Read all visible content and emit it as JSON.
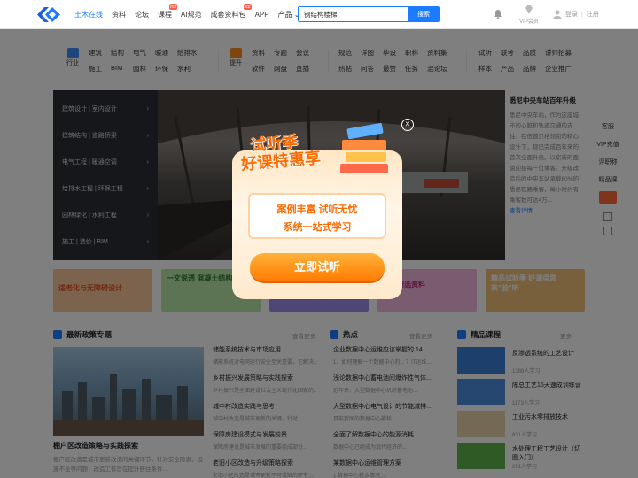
{
  "header": {
    "nav": [
      {
        "label": "土木在线",
        "active": true
      },
      {
        "label": "资料"
      },
      {
        "label": "论坛"
      },
      {
        "label": "课程",
        "badge": "hot"
      },
      {
        "label": "AI规范"
      },
      {
        "label": "成套资料包",
        "badge": "hot"
      },
      {
        "label": "APP"
      },
      {
        "label": "产品 ⌄"
      }
    ],
    "search_value": "钢结构楼梯",
    "search_button": "搜索",
    "vip_label": "VIP会员",
    "login": "登录",
    "register": "注册"
  },
  "categories": {
    "groups": [
      {
        "icon": "industry-icon",
        "name": "行业",
        "items": [
          "建筑",
          "结构",
          "电气",
          "暖通",
          "给排水",
          "施工",
          "BIM",
          "园林",
          "环保",
          "水利"
        ]
      },
      {
        "icon": "promote-icon",
        "name": "提升",
        "items": [
          "资料",
          "专题",
          "会议",
          "软件",
          "网盘",
          "直播"
        ]
      },
      {
        "icon": "forum-icon",
        "name": "",
        "items": [
          "规范",
          "详图",
          "毕设",
          "职称",
          "资料集",
          "热帖",
          "问答",
          "最赞",
          "任务",
          "混论坛"
        ]
      },
      {
        "icon": "exam-icon",
        "name": "",
        "items": [
          "试听",
          "联考",
          "品质",
          "讲师招募",
          "样本",
          "产品",
          "品牌",
          "企业推广"
        ]
      }
    ]
  },
  "hero": {
    "menu": [
      "建筑设计 | 室内设计",
      "建筑结构 | 道路桥梁",
      "电气工程 | 暖通空调",
      "给排水工程 | 环保工程",
      "园林绿化 | 水利工程",
      "施工 | 造价 | BIM"
    ],
    "side_title": "悉尼中央车站百年升级",
    "side_text": "悉尼中央车站，作为这座城市的心脏和轨道交通的支柱，在伍兹贝格领衔的精心设计下，现已完成百年来的首次全面升级。以崭新的面貌迎接每一位乘客。升级改造后的中央车站承载80%的悉尼铁路乘客，每小时约有乘客数可达4万...",
    "side_more": "查看详情"
  },
  "right_sidebar": [
    "客服",
    "VIP充值",
    "评职称",
    "精品课",
    "",
    "",
    ""
  ],
  "banners": [
    {
      "text": "适老化与无障碍设计"
    },
    {
      "text": "一文说透 混凝土结构自防水"
    },
    {
      "text": ""
    },
    {
      "text": "本周精选资料"
    },
    {
      "text": "精品试听季 好课得您来\"验\"听"
    }
  ],
  "policy": {
    "title": "最新政策专题",
    "more": "查看更多",
    "feature_title": "棚户区改造策略与实践探索",
    "feature_text": "棚户区改造是城市更新改造的关键环节，针对安全隐患、设施不全等问题，改造工作旨在提升居住条件...",
    "items": [
      {
        "title": "储能系统技术与市场应用",
        "sub": "储能系统对电网运行安全至关重要，它解决..."
      },
      {
        "title": "乡村振兴发展策略与实践探索",
        "sub": "乡村振兴是全面建设社会主义现代化国家的..."
      },
      {
        "title": "城中村改造实践与思考",
        "sub": "城中村改造是城市更新的关键，针对..."
      },
      {
        "title": "保障房建设模式与发展前景",
        "sub": "保障房建设是城市发展的重要组成部分..."
      },
      {
        "title": "老旧小区改造与升级策略探索",
        "sub": "老旧小区改造是城市更新不可或缺的环节..."
      }
    ]
  },
  "hot": {
    "title": "热点",
    "more": "查看更多",
    "items": [
      {
        "title": "企业数据中心运维应该掌握的 14 ...",
        "sub": "1、如何理解一个数据中心的... ？IT运维..."
      },
      {
        "title": "浅论数据中心蓄电池间爆炸性气体...",
        "sub": "近年来，大型数据中心机房蓄电池..."
      },
      {
        "title": "大型数据中心电气设计的节能减排...",
        "sub": "目前我国的数据中心能耗..."
      },
      {
        "title": "全面了解数据中心的能源消耗",
        "sub": "数据中心已经成为现代经济的..."
      },
      {
        "title": "某数据中心运维管理方案",
        "sub": "1.数据中心基本情况..."
      }
    ]
  },
  "courses": {
    "title": "精品课程",
    "more": "更多",
    "items": [
      {
        "title": "反渗透系统的工艺设计",
        "meta": "1288人学习"
      },
      {
        "title": "陈总工艺15天速成训练营",
        "meta": "1173人学习"
      },
      {
        "title": "工业污水零排放技术",
        "meta": "831人学习"
      },
      {
        "title": "水处理工程工艺设计（切图入门）",
        "meta": "691人学习"
      }
    ]
  },
  "modal": {
    "headline_1": "试听季",
    "headline_2": "好课特惠享",
    "panel_line_1": "案例丰富 试听无忧",
    "panel_line_2": "系统一站式学习",
    "cta": "立即试听",
    "close": "×"
  }
}
